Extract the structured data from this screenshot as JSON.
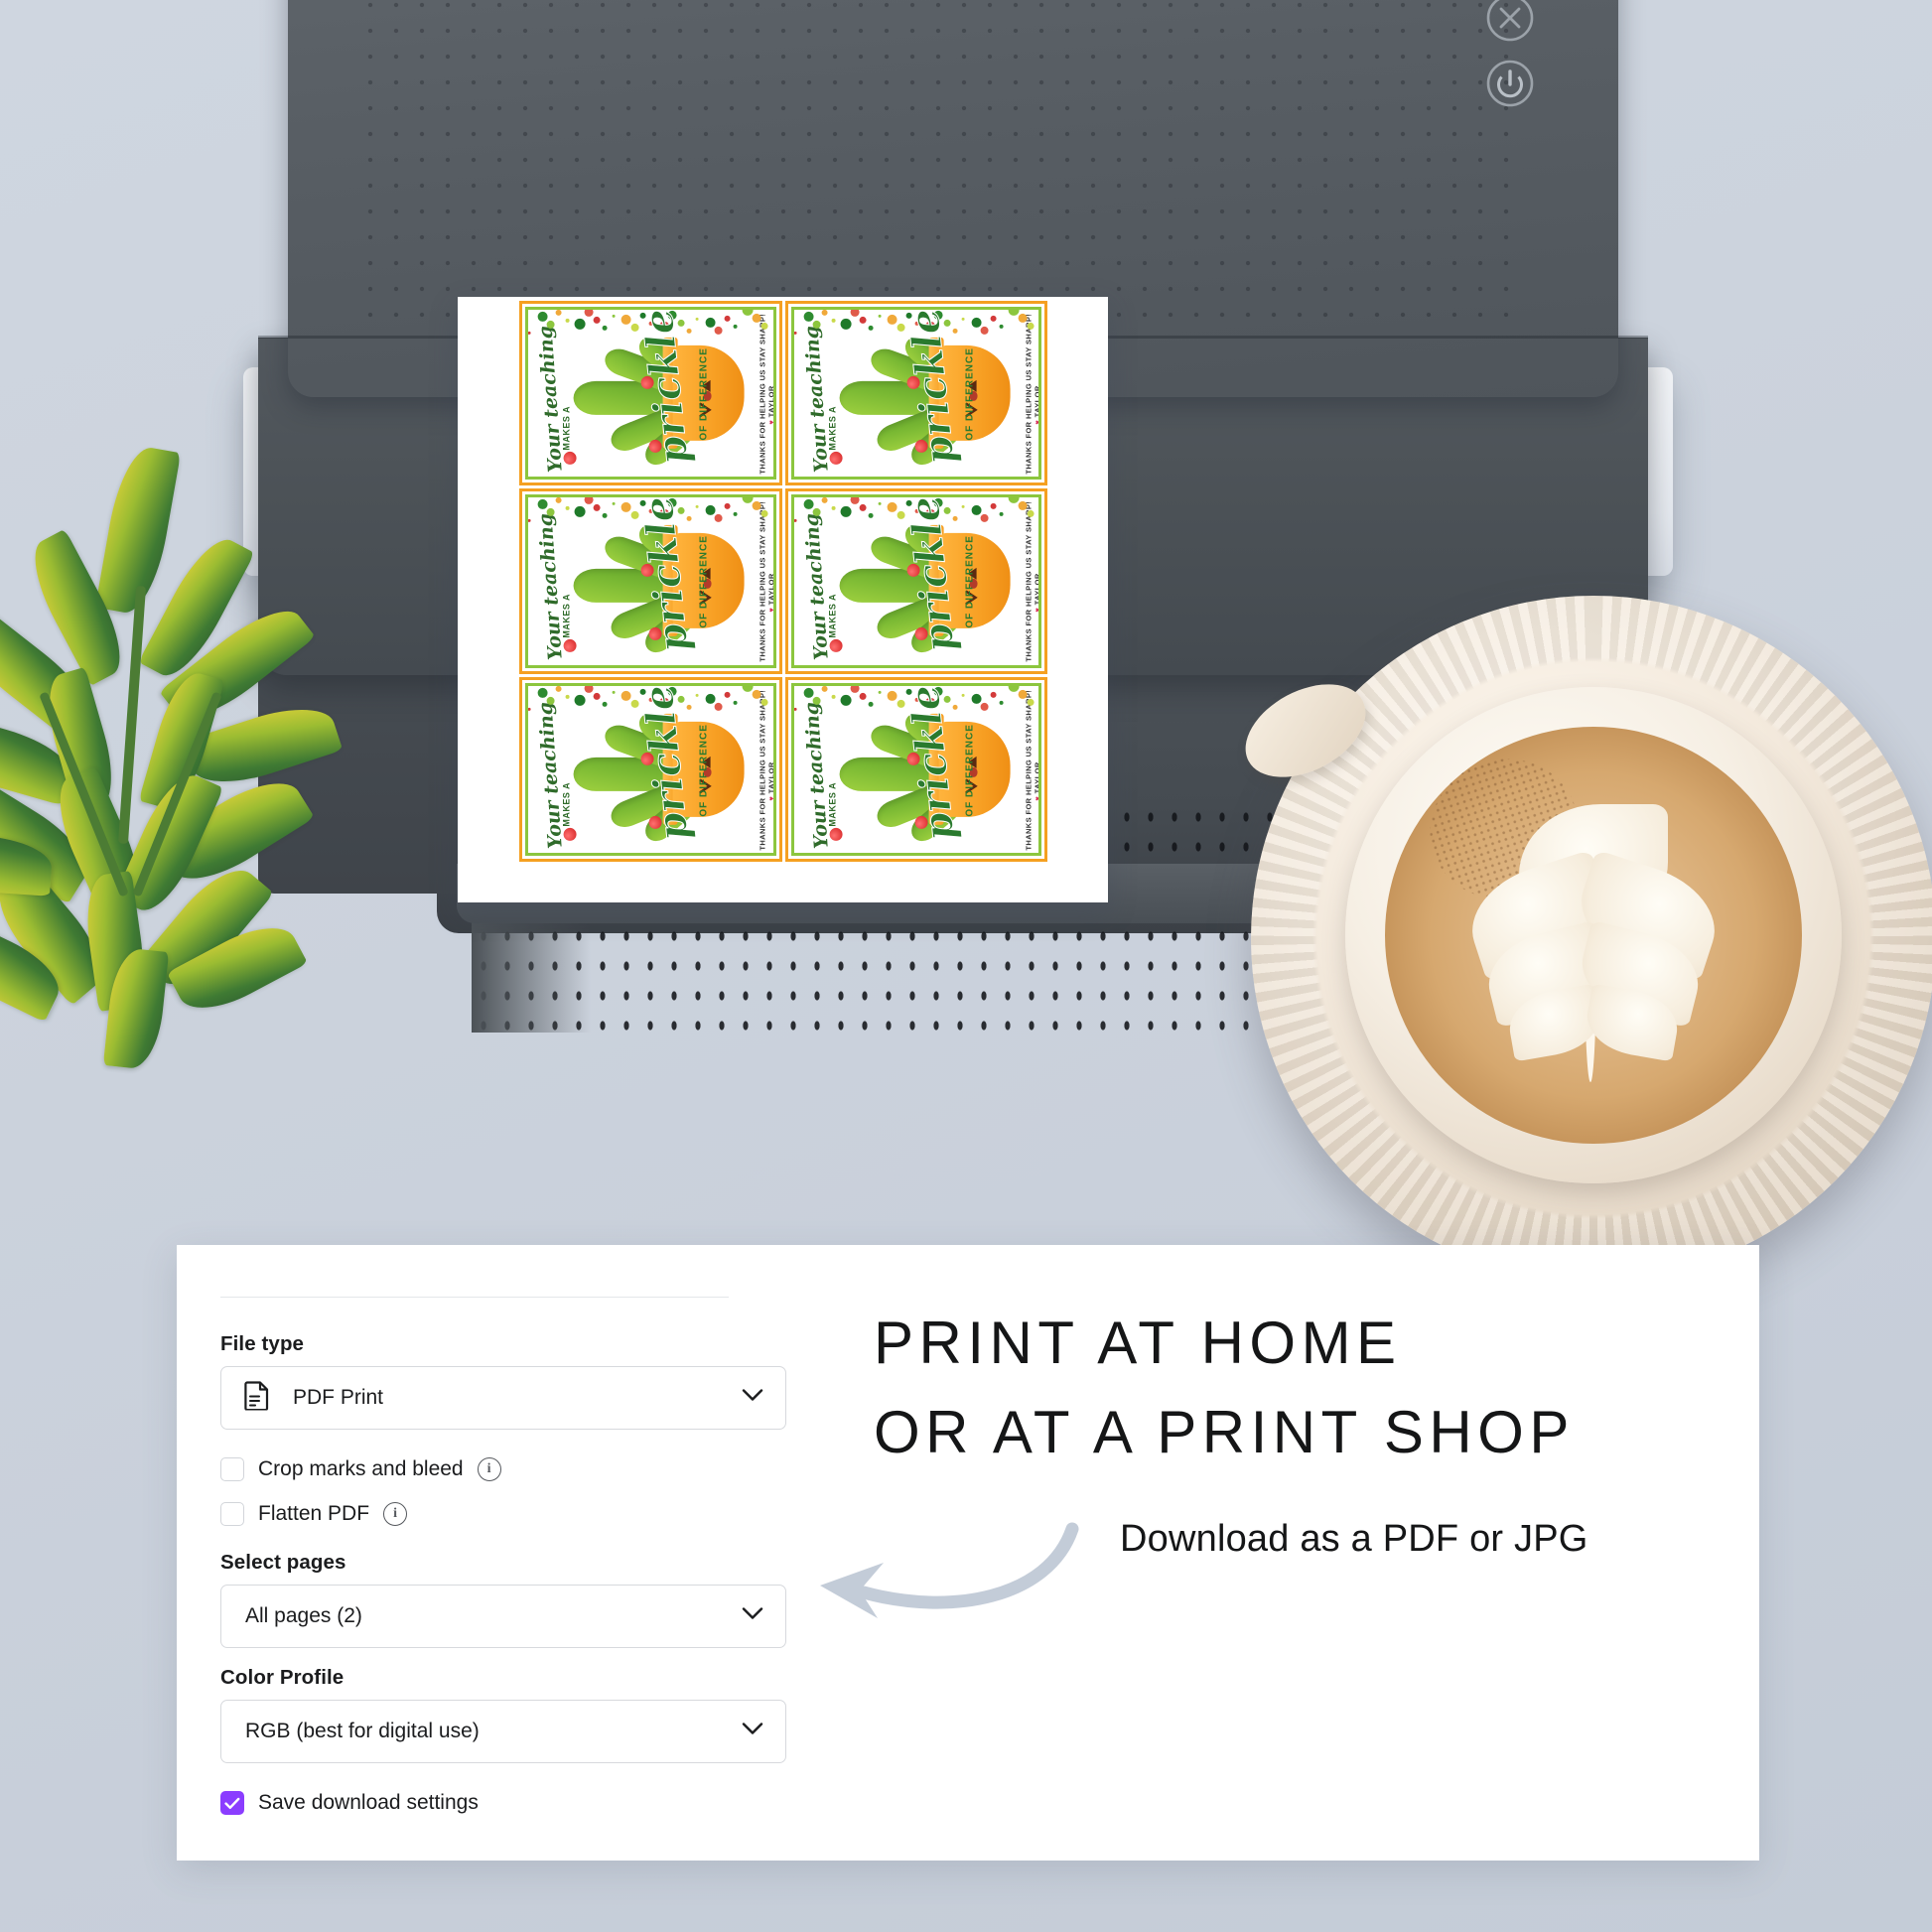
{
  "scene": {
    "background_color": "#ccd3dd",
    "description": "Top-down flat-lay of a printer ejecting a sheet of printed gift tags, with a plant and a latte, and a download-settings dialog overlay"
  },
  "printer": {
    "body_color": "#53595f",
    "buttons": [
      {
        "name": "cancel-button",
        "icon": "close-circle-icon",
        "label": "X"
      },
      {
        "name": "power-button",
        "icon": "power-icon",
        "label": "Power"
      }
    ]
  },
  "printed_sheet": {
    "rows": 3,
    "columns": 2,
    "card_count": 6,
    "card": {
      "line1": "Your teaching",
      "line2": "MAKES A",
      "line3": "prickle",
      "line4": "OF DIFFERENCE",
      "footer": "THANKS FOR HELPING US STAY SHARP!",
      "signature": "TAYLOR",
      "heart": "♥",
      "border_outer_color": "#f5a021",
      "border_inner_color": "#8cc63e",
      "script_color": "#2a7a2e",
      "pot_color": "#f79f23"
    }
  },
  "panel": {
    "file_type": {
      "label": "File type",
      "value": "PDF Print",
      "icon": "document-icon",
      "chevron": "chevron-down-icon"
    },
    "checkboxes": [
      {
        "label": "Crop marks and bleed",
        "checked": false,
        "info": true
      },
      {
        "label": "Flatten PDF",
        "checked": false,
        "info": true
      }
    ],
    "select_pages": {
      "label": "Select pages",
      "value": "All pages (2)",
      "chevron": "chevron-down-icon"
    },
    "color_profile": {
      "label": "Color Profile",
      "value": "RGB (best for digital use)",
      "chevron": "chevron-down-icon"
    },
    "save_settings": {
      "label": "Save download settings",
      "checked": true,
      "accent_color": "#8b3dff",
      "check_glyph": "✓"
    }
  },
  "marketing": {
    "headline_line1": "PRINT AT HOME",
    "headline_line2": "OR AT A PRINT SHOP",
    "subline": "Download as a PDF or JPG",
    "arrow": {
      "name": "curved-arrow-left-icon",
      "color": "#c3ccd8"
    }
  }
}
